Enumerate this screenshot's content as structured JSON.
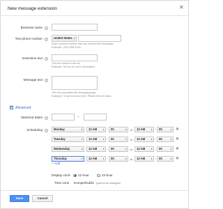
{
  "dialog": {
    "title": "New message extension"
  },
  "form": {
    "business_name": {
      "label": "Business name",
      "value": ""
    },
    "phone": {
      "label": "Text phone number",
      "country": "United States",
      "value": "",
      "hint1": "Enter a phone number that can receive text messages",
      "hint2": "Example: (201) 555-0123"
    },
    "extension_text": {
      "label": "Extension text",
      "value": "",
      "hint1": "This text shows in the ad",
      "hint2": "Example: Text us for more information"
    },
    "message_text": {
      "label": "Message text",
      "value": "",
      "hint1": "This text populates the messaging app.",
      "hint2": "Example: I'd like to know more. Please text me back."
    }
  },
  "advanced": {
    "toggle": "⊟",
    "label": "Advanced",
    "dates": {
      "label": "Start/end dates",
      "start": "",
      "separator": "–",
      "end": ""
    },
    "scheduling": {
      "label": "Scheduling",
      "to_label": "to",
      "rows": [
        {
          "day": "Monday",
          "start_hour": "12 AM",
          "start_min": "00",
          "end_hour": "12 AM",
          "end_min": "00"
        },
        {
          "day": "Tuesday",
          "start_hour": "12 AM",
          "start_min": "00",
          "end_hour": "12 AM",
          "end_min": "00"
        },
        {
          "day": "Wednesday",
          "start_hour": "12 AM",
          "start_min": "00",
          "end_hour": "12 AM",
          "end_min": "00"
        },
        {
          "day": "Thursday",
          "start_hour": "12 AM",
          "start_min": "00",
          "end_hour": "12 AM",
          "end_min": "00"
        }
      ],
      "add_label": "+ Add"
    },
    "display_clock": {
      "label": "Display clock",
      "option_12": "12-hour",
      "option_24": "24-hour",
      "selected": "12-hour"
    },
    "time_zone": {
      "label": "Time zone",
      "value": "Europe/Dublin",
      "note": "(cannot be changed)"
    }
  },
  "footer": {
    "save": "Save",
    "cancel": "Cancel"
  }
}
